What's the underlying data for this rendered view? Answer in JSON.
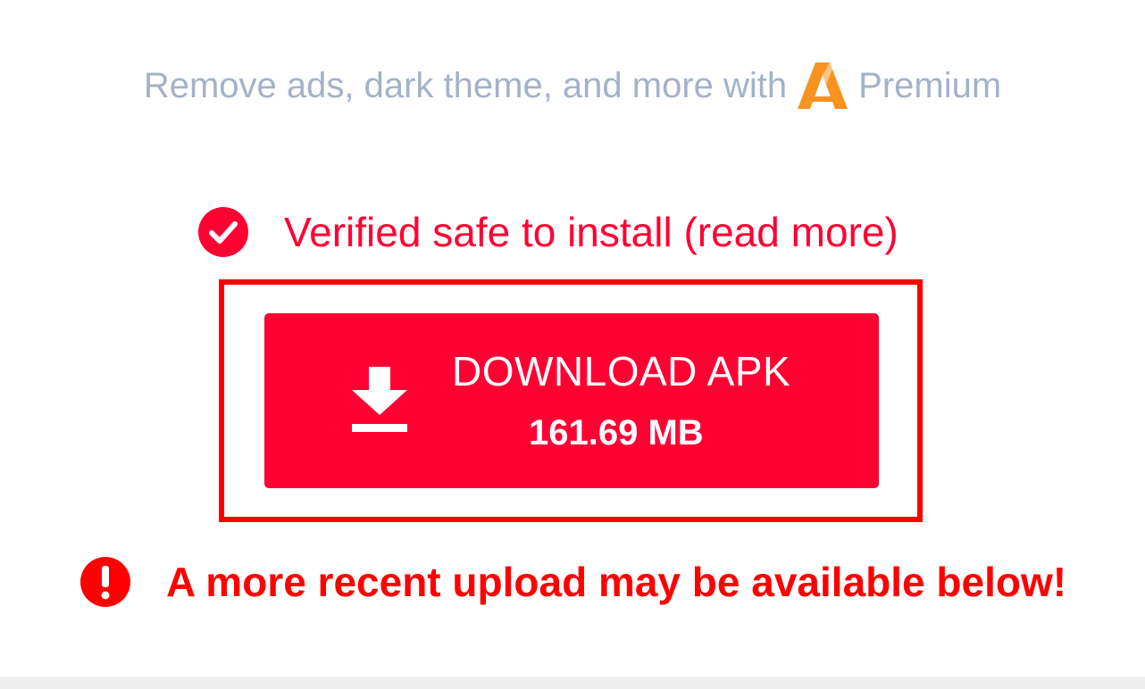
{
  "premium": {
    "text": "Remove ads, dark theme, and more with",
    "brand": "Premium",
    "logo_icon": "apkmirror-logo-icon",
    "logo_color": "#f7931e"
  },
  "verified": {
    "text": "Verified safe to install (read more)",
    "icon": "check-circle-icon",
    "color": "#ff0033"
  },
  "download": {
    "label": "DOWNLOAD APK",
    "size": "161.69 MB",
    "icon": "download-icon",
    "color": "#ff0033",
    "highlight_color": "#ff0000"
  },
  "warning": {
    "text": "A more recent upload may be available below!",
    "icon": "exclamation-circle-icon",
    "color": "#ff0000"
  }
}
